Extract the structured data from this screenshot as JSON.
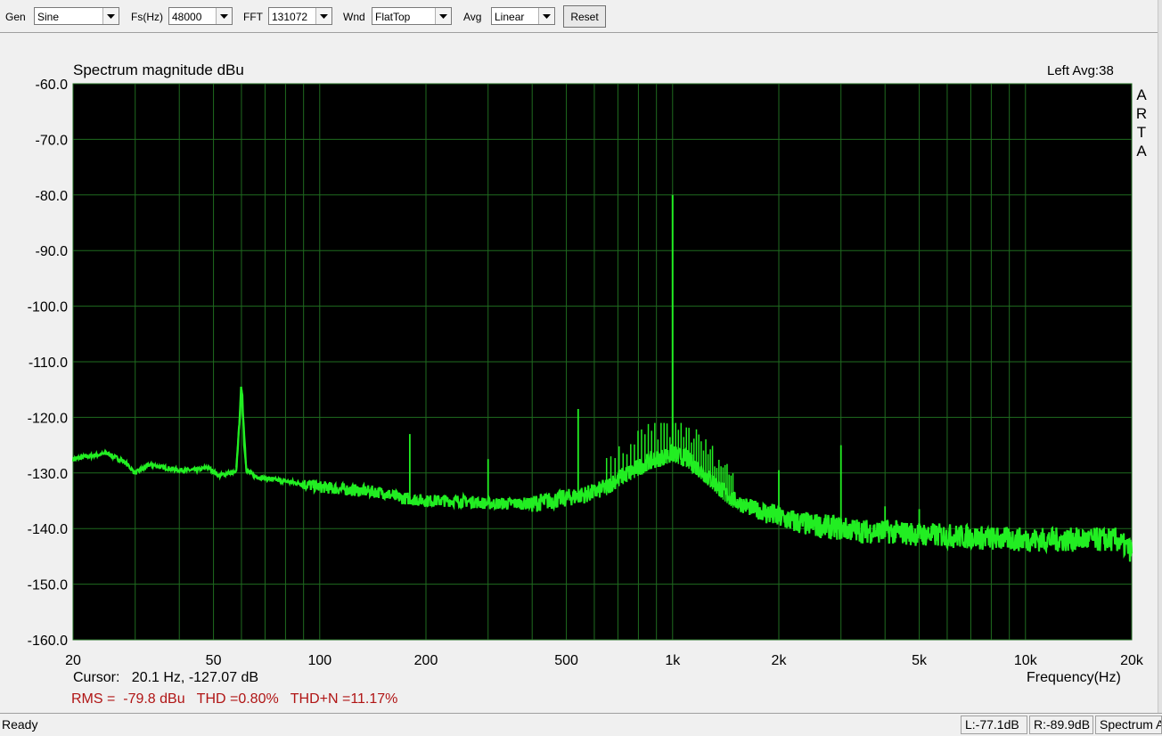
{
  "toolbar": {
    "gen_label": "Gen",
    "gen_value": "Sine",
    "fs_label": "Fs(Hz)",
    "fs_value": "48000",
    "fft_label": "FFT",
    "fft_value": "131072",
    "wnd_label": "Wnd",
    "wnd_value": "FlatTop",
    "avg_label": "Avg",
    "avg_value": "Linear",
    "reset_label": "Reset"
  },
  "chart_header": {
    "title": "Spectrum magnitude dBu",
    "channel": "Left  Avg:38",
    "logo_letters": [
      "A",
      "R",
      "T",
      "A"
    ]
  },
  "readouts": {
    "cursor": "Cursor:   20.1 Hz, -127.07 dB",
    "stats": "RMS =  -79.8 dBu   THD =0.80%   THD+N =11.17%"
  },
  "status": {
    "text": "Ready",
    "left_level": "L:-77.1dB",
    "right_level": "R:-89.9dB",
    "mode": "Spectrum A"
  },
  "colors": {
    "plot_background": "#000000",
    "grid": "#1f6b1f",
    "trace": "#22ee22",
    "stats_text": "#b01515"
  },
  "chart_data": {
    "type": "line",
    "title": "Spectrum magnitude dBu",
    "xlabel": "Frequency(Hz)",
    "ylabel": "",
    "x_scale": "log",
    "xlim": [
      20,
      20000
    ],
    "ylim": [
      -160,
      -60
    ],
    "grid": true,
    "x_ticks": [
      20,
      50,
      100,
      200,
      500,
      1000,
      2000,
      5000,
      10000,
      20000
    ],
    "x_tick_labels": [
      "20",
      "50",
      "100",
      "200",
      "500",
      "1k",
      "2k",
      "5k",
      "10k",
      "20k"
    ],
    "y_ticks": [
      -60,
      -70,
      -80,
      -90,
      -100,
      -110,
      -120,
      -130,
      -140,
      -150,
      -160
    ],
    "y_tick_labels": [
      "-60.0",
      "-70.0",
      "-80.0",
      "-90.0",
      "-100.0",
      "-110.0",
      "-120.0",
      "-130.0",
      "-140.0",
      "-150.0",
      "-160.0"
    ],
    "series": [
      {
        "x": [
          20,
          22,
          25,
          28,
          30,
          33,
          36,
          40,
          45,
          48,
          52,
          55,
          58,
          60,
          62,
          65,
          70,
          80,
          90,
          100,
          120,
          150,
          170,
          200,
          250,
          300,
          350,
          400,
          450,
          500,
          550,
          600,
          650,
          700,
          750,
          800,
          850,
          900,
          950,
          1000,
          1050,
          1100,
          1150,
          1200,
          1300,
          1400,
          1500,
          1700,
          1900,
          2000,
          2300,
          2600,
          3000,
          3500,
          4000,
          5000,
          6000,
          7000,
          8000,
          10000,
          12000,
          15000,
          18000,
          20000
        ],
        "y": [
          -127.5,
          -127,
          -126.5,
          -128,
          -130,
          -128.5,
          -129,
          -129.5,
          -129.5,
          -129,
          -130.5,
          -130,
          -130,
          -115,
          -129.5,
          -130.5,
          -131,
          -131.5,
          -132,
          -132.5,
          -133,
          -133.5,
          -134.5,
          -135,
          -135,
          -135.5,
          -135.5,
          -135.5,
          -135,
          -134.5,
          -134,
          -133.5,
          -132.5,
          -131,
          -130,
          -129,
          -128,
          -127.5,
          -127,
          -126.5,
          -127,
          -127.5,
          -128.5,
          -129.5,
          -131.5,
          -133.5,
          -135,
          -136.5,
          -137.5,
          -138,
          -139,
          -139.5,
          -140,
          -140.5,
          -140.5,
          -141,
          -141.3,
          -141.5,
          -141.8,
          -142,
          -142,
          -142,
          -142,
          -144
        ]
      }
    ],
    "peaks": [
      {
        "x": 60,
        "y": -114.5
      },
      {
        "x": 180,
        "y": -123
      },
      {
        "x": 300,
        "y": -127.5
      },
      {
        "x": 540,
        "y": -118.5
      },
      {
        "x": 1000,
        "y": -80
      },
      {
        "x": 2000,
        "y": -129.5
      },
      {
        "x": 3000,
        "y": -125
      },
      {
        "x": 4000,
        "y": -136
      },
      {
        "x": 5000,
        "y": -136.5
      }
    ]
  }
}
